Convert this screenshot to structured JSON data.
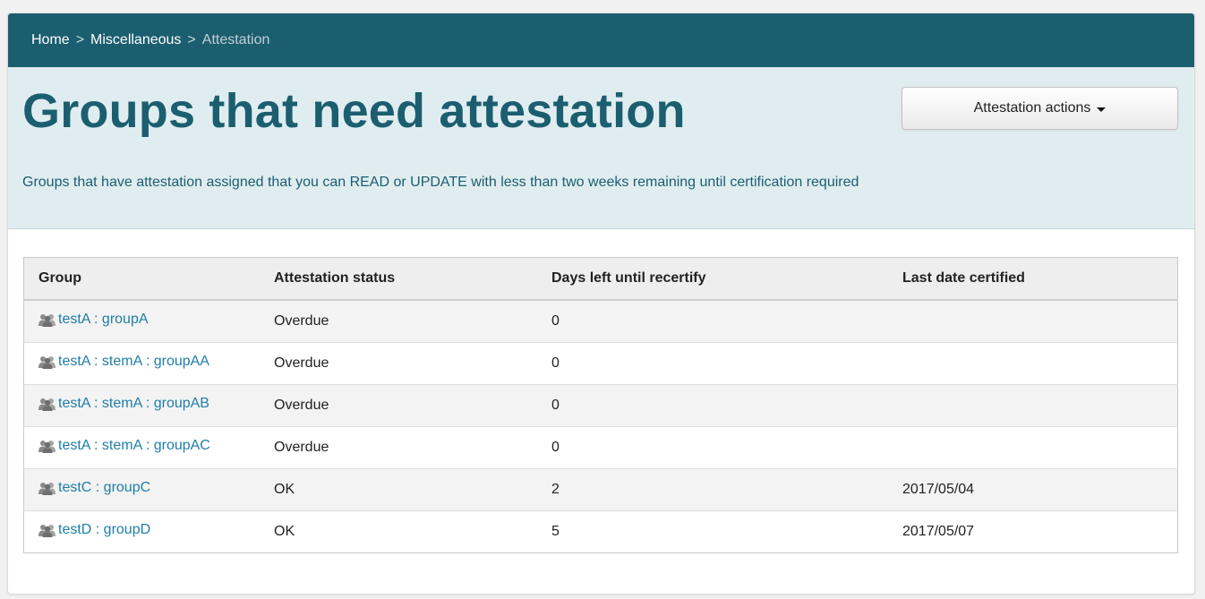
{
  "breadcrumb": {
    "home": "Home",
    "separator": ">",
    "miscellaneous": "Miscellaneous",
    "current": "Attestation"
  },
  "header": {
    "title": "Groups that need attestation",
    "actions_button": "Attestation actions",
    "subtitle": "Groups that have attestation assigned that you can READ or UPDATE with less than two weeks remaining until certification required"
  },
  "table": {
    "columns": [
      "Group",
      "Attestation status",
      "Days left until recertify",
      "Last date certified"
    ],
    "rows": [
      {
        "icon": "group-icon",
        "group": "testA : groupA",
        "status": "Overdue",
        "days": "0",
        "last_certified": ""
      },
      {
        "icon": "group-icon",
        "group": "testA : stemA : groupAA",
        "status": "Overdue",
        "days": "0",
        "last_certified": ""
      },
      {
        "icon": "group-icon",
        "group": "testA : stemA : groupAB",
        "status": "Overdue",
        "days": "0",
        "last_certified": ""
      },
      {
        "icon": "group-icon",
        "group": "testA : stemA : groupAC",
        "status": "Overdue",
        "days": "0",
        "last_certified": ""
      },
      {
        "icon": "group-icon",
        "group": "testC : groupC",
        "status": "OK",
        "days": "2",
        "last_certified": "2017/05/04"
      },
      {
        "icon": "group-icon",
        "group": "testD : groupD",
        "status": "OK",
        "days": "5",
        "last_certified": "2017/05/07"
      }
    ]
  },
  "colors": {
    "brand": "#1b5e70",
    "header_panel": "#e0edf0",
    "link": "#1f7ea8"
  }
}
